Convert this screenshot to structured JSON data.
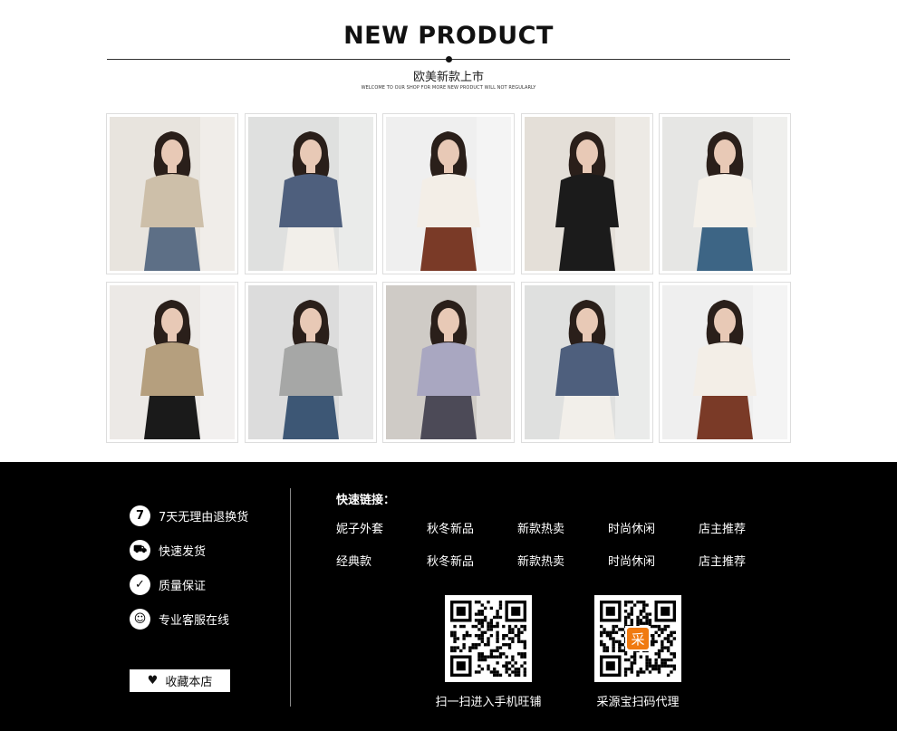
{
  "header": {
    "title": "NEW PRODUCT",
    "subtitle": "欧美新款上市",
    "tagline": "WELCOME TO OUR SHOP FOR MORE NEW PRODUCT WILL NOT REGULARLY"
  },
  "colors": {
    "footer_bg": "#000000",
    "text_dark": "#111111",
    "card_border": "#dddddd"
  },
  "products": [
    {
      "name": "product-1",
      "outfit": "beige long coat, jeans"
    },
    {
      "name": "product-2",
      "outfit": "plaid knit sweater"
    },
    {
      "name": "product-3",
      "outfit": "white ruffle blouse"
    },
    {
      "name": "product-4",
      "outfit": "black double-breasted dress, beret"
    },
    {
      "name": "product-5",
      "outfit": "white twist top, blue skirt"
    },
    {
      "name": "product-6",
      "outfit": "camel cable cardigan"
    },
    {
      "name": "product-7",
      "outfit": "grey ruffle sweater"
    },
    {
      "name": "product-8",
      "outfit": "lilac satin shirt"
    },
    {
      "name": "product-9",
      "outfit": "plaid knit sweater"
    },
    {
      "name": "product-10",
      "outfit": "white ruffle blouse"
    }
  ],
  "footer": {
    "services": [
      {
        "icon": "seven-days-icon",
        "glyph": "7",
        "label": "7天无理由退换货"
      },
      {
        "icon": "truck-icon",
        "glyph": "⛟",
        "label": "快速发货"
      },
      {
        "icon": "check-icon",
        "glyph": "✓",
        "label": "质量保证"
      },
      {
        "icon": "chat-icon",
        "glyph": "☺",
        "label": "专业客服在线"
      }
    ],
    "favorite_label": "收藏本店",
    "favorite_icon": "heart-icon",
    "quick_links_title": "快速链接：",
    "quick_links": [
      [
        "妮子外套",
        "秋冬新品",
        "新款热卖",
        "时尚休闲",
        "店主推荐"
      ],
      [
        "经典款",
        "秋冬新品",
        "新款热卖",
        "时尚休闲",
        "店主推荐"
      ]
    ],
    "qr_codes": [
      {
        "caption": "扫一扫进入手机旺铺",
        "badge": ""
      },
      {
        "caption": "采源宝扫码代理",
        "badge": "采"
      }
    ]
  }
}
